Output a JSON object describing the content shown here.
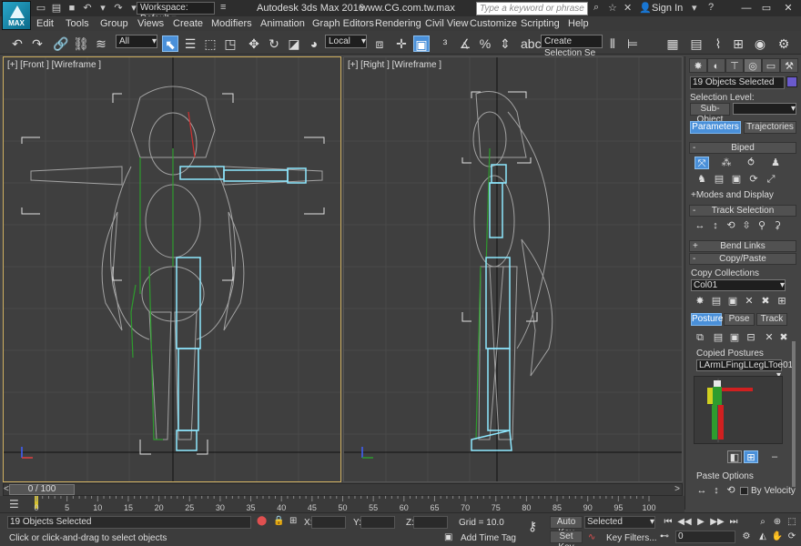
{
  "titlebar": {
    "logo_text": "MAX",
    "workspace": "Workspace: Default",
    "app_title": "Autodesk 3ds Max 2016",
    "site": "www.CG.com.tw.max",
    "search_placeholder": "Type a keyword or phrase",
    "signin": "Sign In"
  },
  "menu": [
    "Edit",
    "Tools",
    "Group",
    "Views",
    "Create",
    "Modifiers",
    "Animation",
    "Graph Editors",
    "Rendering",
    "Civil View",
    "Customize",
    "Scripting",
    "Help"
  ],
  "toolbar": {
    "filter_value": "All",
    "coord_value": "Local",
    "selection_set": "Create Selection Se"
  },
  "viewports": {
    "front_label": "[+] [Front ] [Wireframe ]",
    "right_label": "[+] [Right ] [Wireframe ]"
  },
  "panel": {
    "objects_selected": "19 Objects Selected",
    "selection_level": "Selection Level:",
    "sub_object": "Sub-Object",
    "tab_parameters": "Parameters",
    "tab_trajectories": "Trajectories",
    "rollout_biped": "Biped",
    "modes_display": "Modes and Display",
    "rollout_track": "Track Selection",
    "rollout_bend": "Bend Links",
    "rollout_copy": "Copy/Paste",
    "copy_collections": "Copy Collections",
    "collection_value": "Col01",
    "tab_posture": "Posture",
    "tab_pose": "Pose",
    "tab_track": "Track",
    "copied_postures": "Copied Postures",
    "posture_value": "LArmLFingLLegLToe01",
    "paste_options": "Paste Options",
    "by_velocity": "By Velocity"
  },
  "timeline": {
    "slider_label": "0 / 100",
    "ticks": [
      0,
      5,
      10,
      15,
      20,
      25,
      30,
      35,
      40,
      45,
      50,
      55,
      60,
      65,
      70,
      75,
      80,
      85,
      90,
      95,
      100
    ]
  },
  "status": {
    "selected": "19 Objects Selected",
    "prompt": "Click or click-and-drag to select objects",
    "x_label": "X:",
    "y_label": "Y:",
    "z_label": "Z:",
    "grid": "Grid = 10.0",
    "add_time_tag": "Add Time Tag",
    "auto_key": "Auto Key",
    "set_key": "Set Key",
    "key_mode": "Selected",
    "key_filters": "Key Filters...",
    "frame": "0"
  },
  "colors": {
    "accent": "#4a90d9",
    "active_viewport_border": "#d0b060",
    "biped_selected": "#8ee8ff",
    "skin": "#e8e8e8",
    "bones": "#2e9c2e"
  }
}
